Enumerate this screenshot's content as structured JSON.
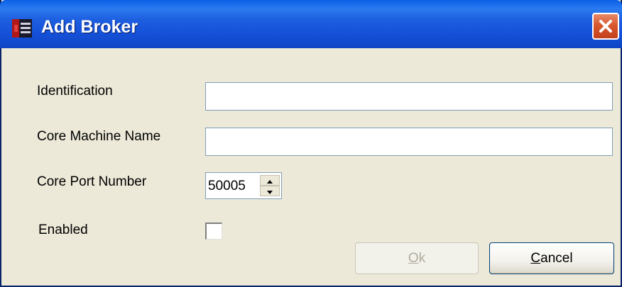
{
  "window": {
    "title": "Add Broker",
    "icon": "app-icon",
    "close_icon": "close-icon"
  },
  "form": {
    "identification": {
      "label": "Identification",
      "value": ""
    },
    "core_machine_name": {
      "label": "Core Machine Name",
      "value": ""
    },
    "core_port_number": {
      "label": "Core Port Number",
      "value": "50005"
    },
    "enabled": {
      "label": "Enabled",
      "checked": false
    }
  },
  "buttons": {
    "ok_label": "Ok",
    "cancel_label": "Cancel"
  },
  "colors": {
    "titlebar": "#1e5fe0",
    "close_button": "#d8582e",
    "dialog_background": "#ece9d8"
  }
}
